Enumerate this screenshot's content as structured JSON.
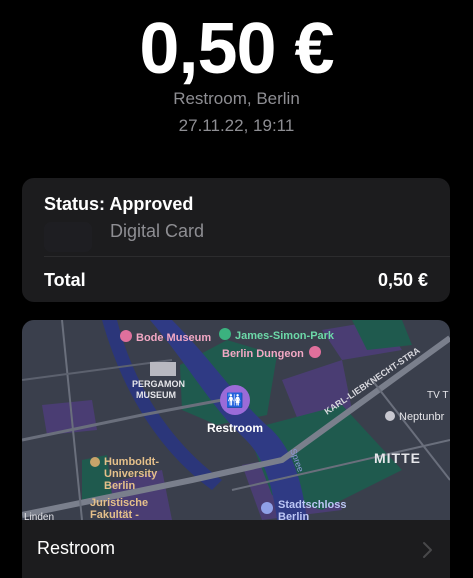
{
  "transaction": {
    "amount": "0,50 €",
    "merchant": "Restroom, Berlin",
    "datetime": "27.11.22, 19:11"
  },
  "details": {
    "status": "Status: Approved",
    "card_name": "Digital Card",
    "total_label": "Total",
    "total_value": "0,50 €"
  },
  "map": {
    "labels": {
      "bode_museum": "Bode Museum",
      "james_simon_park": "James-Simon-Park",
      "berlin_dungeon": "Berlin Dungeon",
      "pergamon_1": "PERGAMON",
      "pergamon_2": "MUSEUM",
      "karl_liebknecht": "KARL-LIEBKNECHT-STRA",
      "tv": "TV T",
      "neptun": "Neptunbr",
      "restroom_pin": "Restroom",
      "spree": "Spree",
      "mitte": "MITTE",
      "humboldt_1": "Humboldt-",
      "humboldt_2": "University",
      "humboldt_3": "Berlin",
      "juristische_1": "Juristische",
      "juristische_2": "Fakultät -",
      "linden": "Linden",
      "stadtschloss_1": "Stadtschloss",
      "stadtschloss_2": "Berlin"
    },
    "colors": {
      "base": "#3a3f4c",
      "water": "#2f3a84",
      "green": "#1f5a4e",
      "purple_block": "#4a3d73",
      "road": "#7a7f8c",
      "pin": "#9b6bd8"
    },
    "icons": {
      "museum_marker": "museum-icon",
      "park_marker": "park-icon",
      "attraction_marker": "attraction-icon",
      "restroom_marker": "restroom-icon",
      "school_marker": "school-icon",
      "landmark_marker": "landmark-icon"
    }
  },
  "map_footer": {
    "label": "Restroom"
  }
}
